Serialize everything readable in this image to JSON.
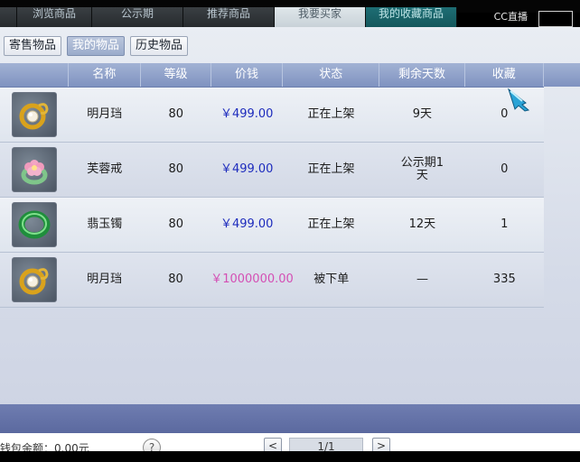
{
  "top_tabs": [
    {
      "label": "浏览商品",
      "width": 80
    },
    {
      "label": "公示期",
      "width": 100
    },
    {
      "label": "推荐商品",
      "width": 100
    },
    {
      "label": "我要买家",
      "width": 100
    },
    {
      "label": "我的收藏商品",
      "width": 100
    }
  ],
  "logo": "CC直播",
  "subtabs": [
    "寄售物品",
    "我的物品",
    "历史物品"
  ],
  "columns": [
    "",
    "名称",
    "等级",
    "价钱",
    "状态",
    "剩余天数",
    "收藏"
  ],
  "rows": [
    {
      "icon": "pearl-earring-icon",
      "name": "明月珰",
      "level": "80",
      "price": "￥499.00",
      "status": "正在上架",
      "days": "9天",
      "fav": "0"
    },
    {
      "icon": "flower-ring-icon",
      "name": "芙蓉戒",
      "level": "80",
      "price": "￥499.00",
      "status": "正在上架",
      "days": "公示期1天",
      "fav": "0"
    },
    {
      "icon": "jade-bracelet-icon",
      "name": "翡玉镯",
      "level": "80",
      "price": "￥499.00",
      "status": "正在上架",
      "days": "12天",
      "fav": "1"
    },
    {
      "icon": "pearl-earring-icon",
      "name": "明月珰",
      "level": "80",
      "price": "￥1000000.00",
      "status": "被下单",
      "days": "—",
      "fav": "335"
    }
  ],
  "footer": {
    "balance": "钱包余额：0.00元",
    "help": "?",
    "page": "1/1",
    "prev": "<",
    "next": ">"
  },
  "colors": {
    "header": "#8c9dc8",
    "price": "#1e2cbd",
    "price_alt": "#d44fb4"
  }
}
